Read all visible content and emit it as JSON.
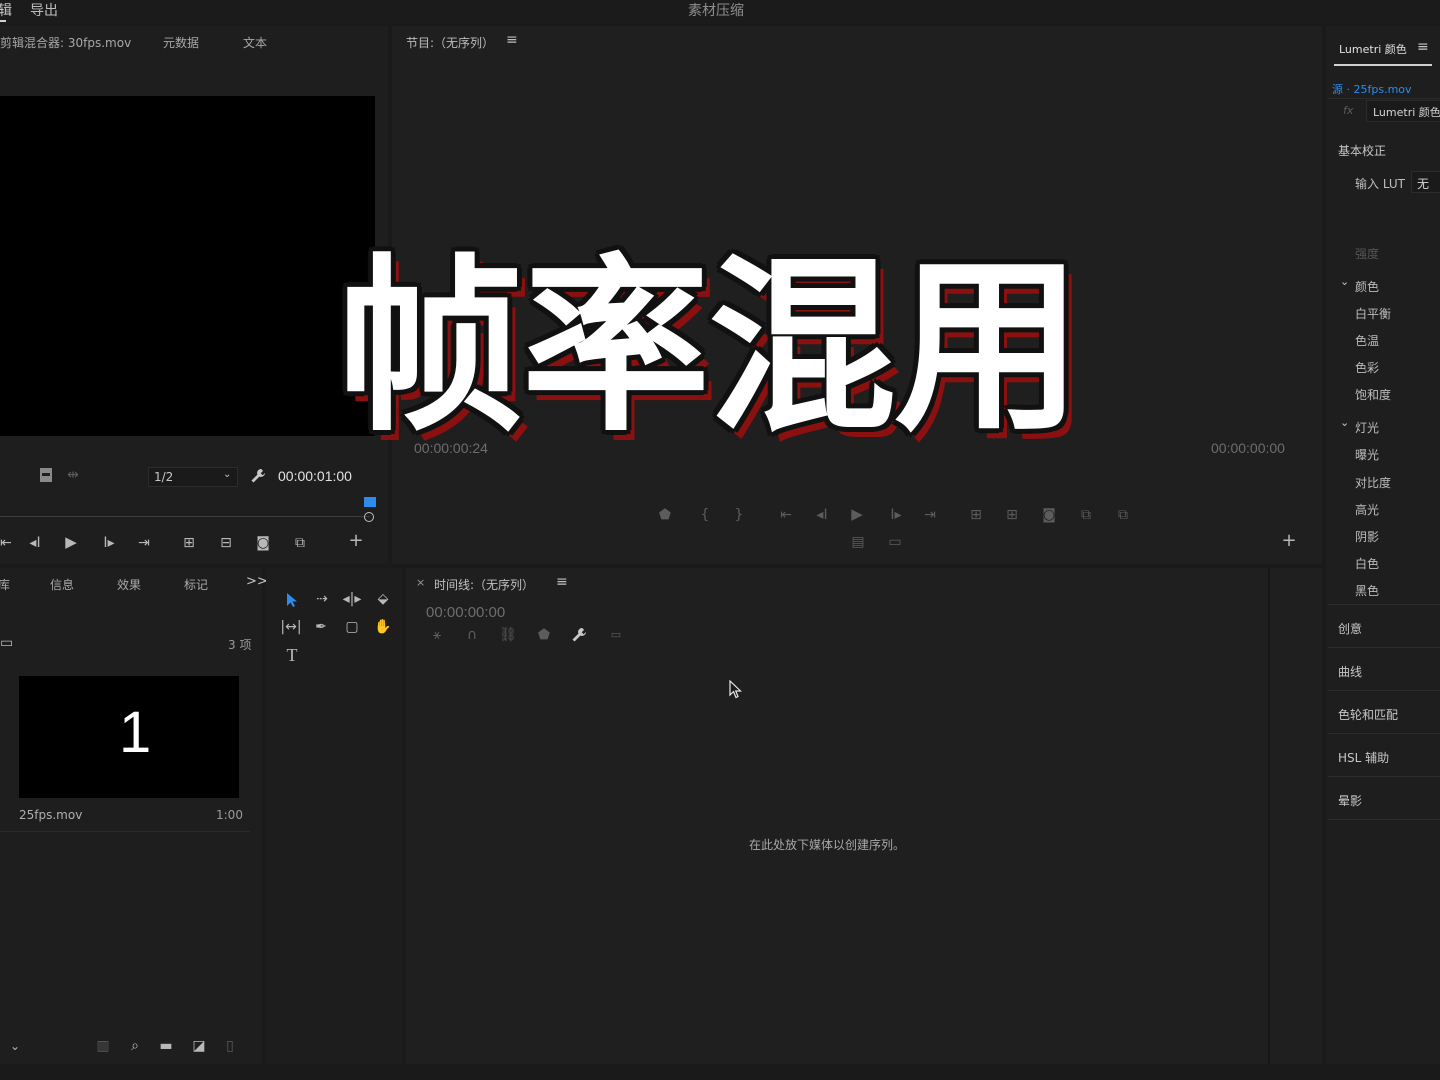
{
  "menubar": {
    "edit_partial": "辑",
    "export": "导出",
    "app_title": "素材压缩"
  },
  "source_panel": {
    "tab_mixer": "剪辑混合器: 30fps.mov",
    "tab_metadata": "元数据",
    "tab_text": "文本",
    "resolution": "1/2",
    "timecode": "00:00:01:00"
  },
  "program_panel": {
    "title": "节目:（无序列）",
    "timecode_left": "00:00:00:24",
    "timecode_right": "00:00:00:00"
  },
  "overlay": {
    "caption": "帧率混用"
  },
  "project_panel": {
    "tab_lib_partial": "库",
    "tab_info": "信息",
    "tab_effects": "效果",
    "tab_markers": "标记",
    "overflow": ">>",
    "item_count": "3 项",
    "clip_thumb_number": "1",
    "clip_name": "25fps.mov",
    "clip_duration": "1:00"
  },
  "timeline_panel": {
    "title": "时间线:（无序列）",
    "timecode": "00:00:00:00",
    "empty_message": "在此处放下媒体以创建序列。"
  },
  "lumetri": {
    "tab_title": "Lumetri 颜色",
    "source": "源 · 25fps.mov",
    "fx_label": "fx",
    "effect_name": "Lumetri 颜色",
    "basic_correction": "基本校正",
    "input_lut": "输入 LUT",
    "input_lut_value": "无",
    "intensity": "强度",
    "color_group": "颜色",
    "white_balance": "白平衡",
    "temperature": "色温",
    "tint": "色彩",
    "saturation": "饱和度",
    "light_group": "灯光",
    "exposure": "曝光",
    "contrast": "对比度",
    "highlights": "高光",
    "shadows": "阴影",
    "whites": "白色",
    "blacks": "黑色",
    "creative": "创意",
    "curves": "曲线",
    "color_wheels": "色轮和匹配",
    "hsl": "HSL 辅助",
    "vignette": "晕影"
  },
  "colors": {
    "accent_blue": "#2d8ceb",
    "caption_shadow": "#8b1010"
  }
}
